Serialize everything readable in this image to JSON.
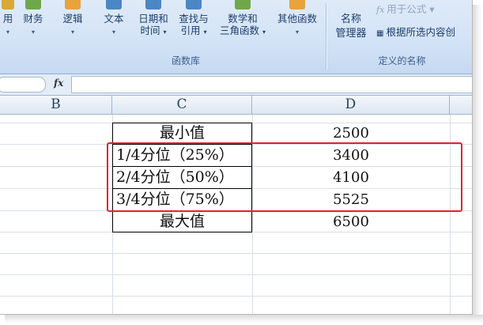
{
  "ribbon": {
    "buttons": [
      {
        "label": "用",
        "arrow": "▾",
        "icon_color": "#d8a83a"
      },
      {
        "label": "财务",
        "arrow": "▾",
        "icon_color": "#6ea84a"
      },
      {
        "label": "逻辑",
        "arrow": "▾",
        "icon_color": "#e8a33c"
      },
      {
        "label": "文本",
        "arrow": "▾",
        "icon_color": "#4b86c5"
      },
      {
        "label": "日期和",
        "label2": "时间",
        "arrow": "▾",
        "icon_color": "#4b86c5"
      },
      {
        "label": "查找与",
        "label2": "引用",
        "arrow": "▾",
        "icon_color": "#4b86c5"
      },
      {
        "label": "数学和",
        "label2": "三角函数",
        "arrow": "▾",
        "icon_color": "#6ea84a"
      },
      {
        "label": "其他函数",
        "arrow": "▾",
        "icon_color": "#e8a33c"
      }
    ],
    "group_function_library": "函数库",
    "name_manager_line1": "名称",
    "name_manager_line2": "管理器",
    "use_in_formula": "用于公式 ▾",
    "create_from_selection": "根据所选内容创",
    "group_defined_names": "定义的名称"
  },
  "formula_bar": {
    "fx": "fx",
    "content": ""
  },
  "columns": [
    "B",
    "C",
    "D"
  ],
  "table": {
    "rows": [
      {
        "c": "最小值",
        "d": "2500"
      },
      {
        "c": "1/4分位（25%）",
        "d": "3400"
      },
      {
        "c": "2/4分位（50%）",
        "d": "4100"
      },
      {
        "c": "3/4分位（75%）",
        "d": "5525"
      },
      {
        "c": "最大值",
        "d": "6500"
      }
    ]
  },
  "colors": {
    "highlight": "#e0242c",
    "ribbon": "#d3e3f6"
  }
}
